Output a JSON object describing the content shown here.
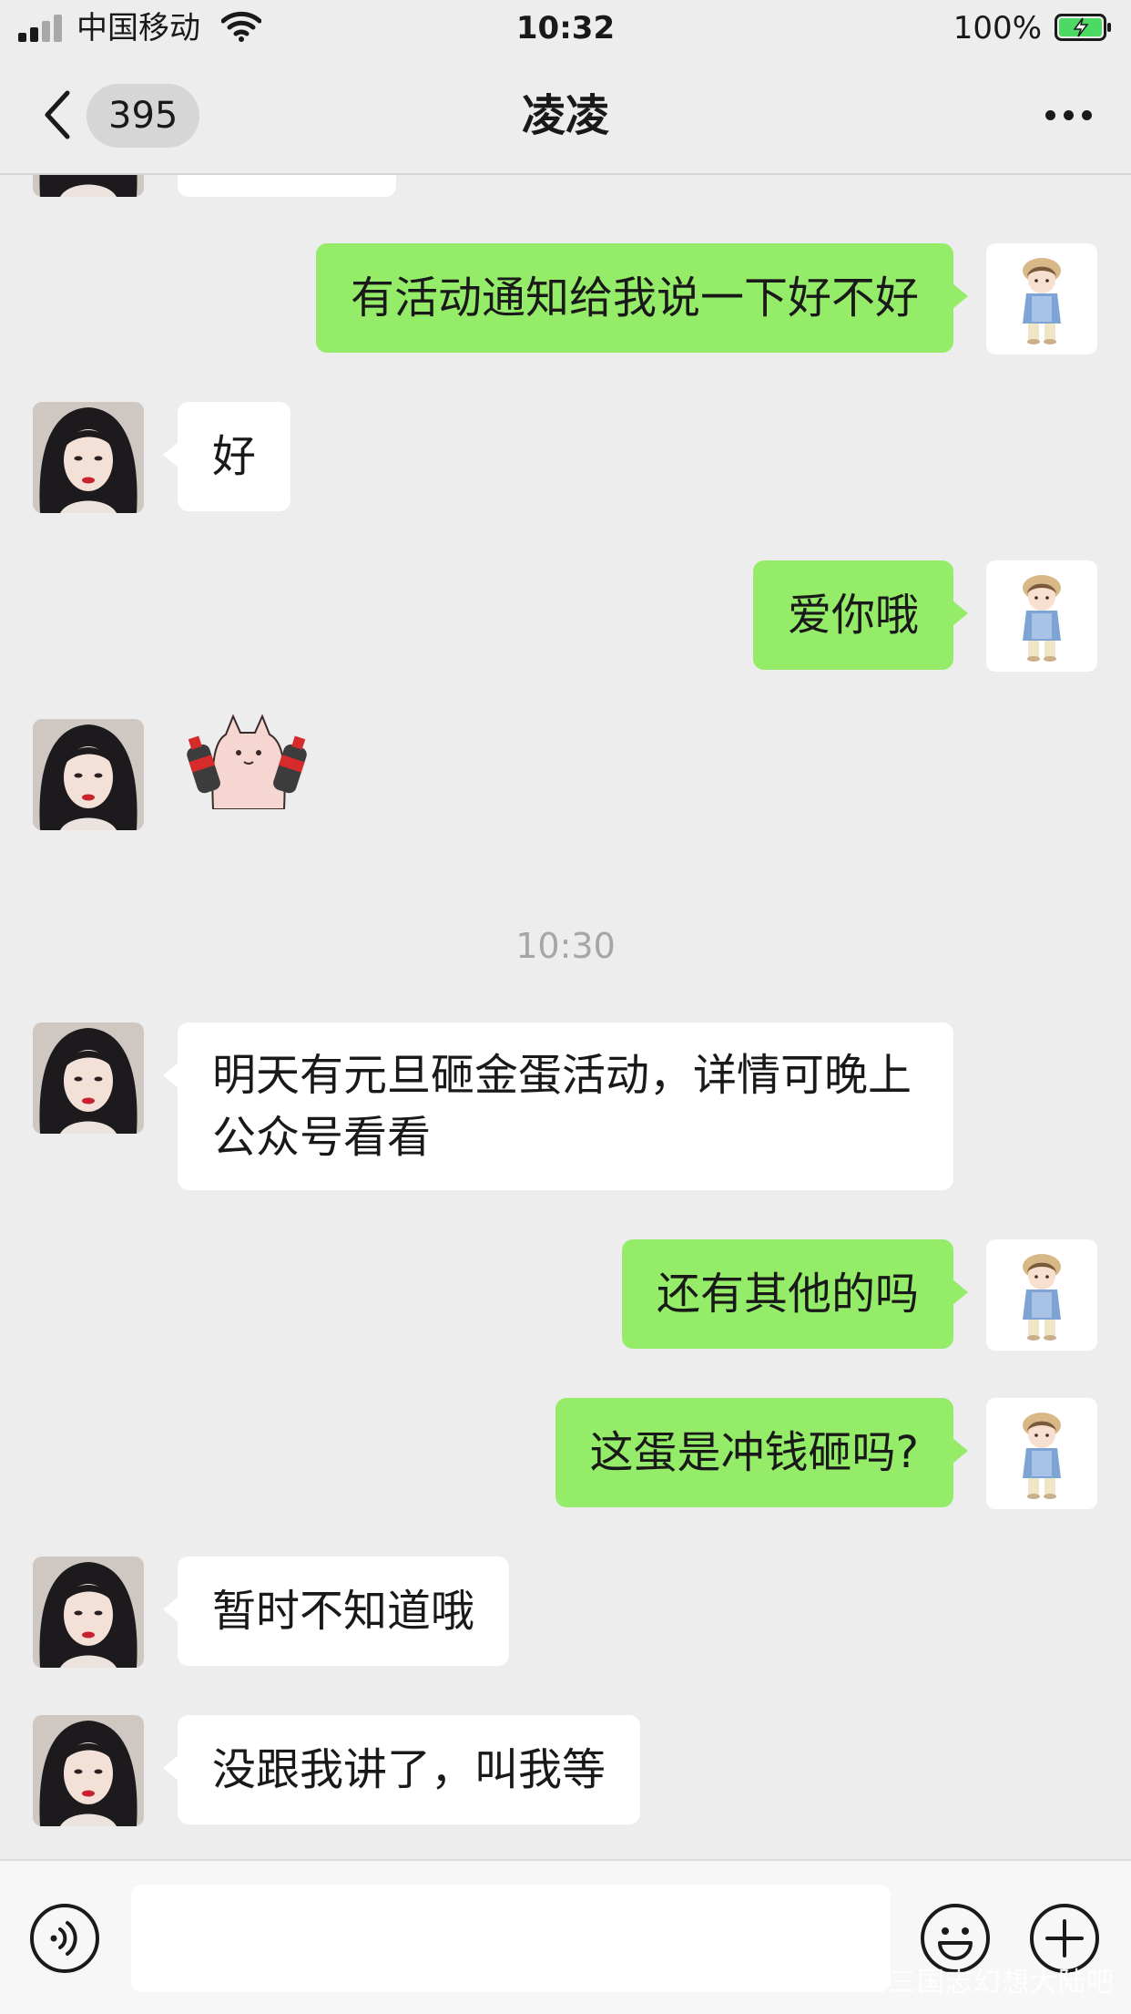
{
  "status_bar": {
    "carrier": "中国移动",
    "time": "10:32",
    "battery_percent": "100%",
    "signal_level": 0.5
  },
  "nav": {
    "unread_count": "395",
    "title": "凌凌"
  },
  "chat": {
    "timestamp": "10:30",
    "messages": [
      {
        "from": "me",
        "text": "有活动通知给我说一下好不好"
      },
      {
        "from": "contact",
        "text": "好"
      },
      {
        "from": "me",
        "text": "爱你哦"
      },
      {
        "from": "contact",
        "sticker": "pink-cat-holding-cola-sticker"
      },
      {
        "from": "contact",
        "text": "明天有元旦砸金蛋活动，详情可晚上公众号看看"
      },
      {
        "from": "me",
        "text": "还有其他的吗"
      },
      {
        "from": "me",
        "text": "这蛋是冲钱砸吗?"
      },
      {
        "from": "contact",
        "text": "暂时不知道哦"
      },
      {
        "from": "contact",
        "text": "没跟我讲了，叫我等"
      }
    ]
  },
  "input_bar": {
    "watermark": "三国志幻想大陆吧"
  },
  "colors": {
    "outgoing_bubble": "#95ec69",
    "incoming_bubble": "#ffffff",
    "background": "#ededed"
  }
}
